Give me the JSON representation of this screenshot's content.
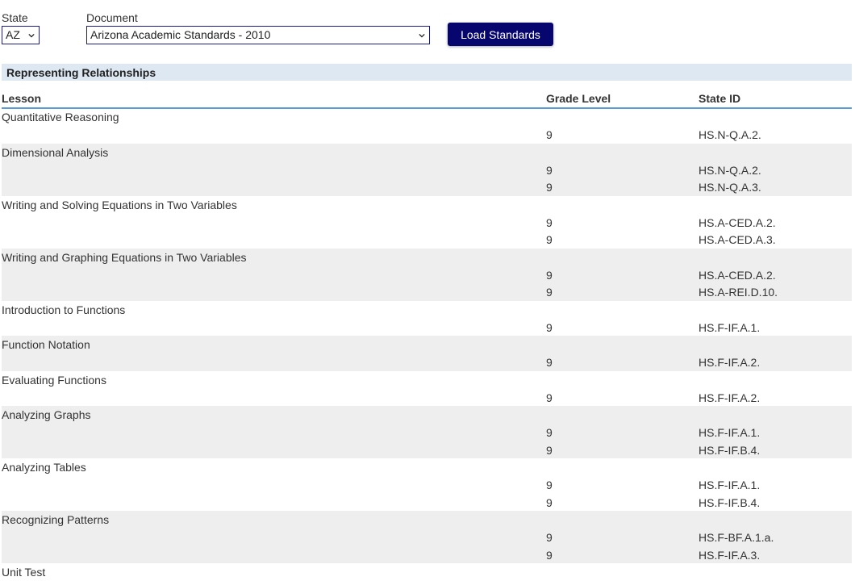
{
  "controls": {
    "state_label": "State",
    "state_value": "AZ",
    "document_label": "Document",
    "document_value": "Arizona Academic Standards - 2010",
    "load_button": "Load Standards"
  },
  "section": {
    "title": "Representing Relationships"
  },
  "columns": {
    "lesson": "Lesson",
    "grade": "Grade Level",
    "state_id": "State ID"
  },
  "lessons": [
    {
      "title": "Quantitative Reasoning",
      "standards": [
        {
          "grade": "9",
          "id": "HS.N-Q.A.2."
        }
      ]
    },
    {
      "title": "Dimensional Analysis",
      "standards": [
        {
          "grade": "9",
          "id": "HS.N-Q.A.2."
        },
        {
          "grade": "9",
          "id": "HS.N-Q.A.3."
        }
      ]
    },
    {
      "title": "Writing and Solving Equations in Two Variables",
      "standards": [
        {
          "grade": "9",
          "id": "HS.A-CED.A.2."
        },
        {
          "grade": "9",
          "id": "HS.A-CED.A.3."
        }
      ]
    },
    {
      "title": "Writing and Graphing Equations in Two Variables",
      "standards": [
        {
          "grade": "9",
          "id": "HS.A-CED.A.2."
        },
        {
          "grade": "9",
          "id": "HS.A-REI.D.10."
        }
      ]
    },
    {
      "title": "Introduction to Functions",
      "standards": [
        {
          "grade": "9",
          "id": "HS.F-IF.A.1."
        }
      ]
    },
    {
      "title": "Function Notation",
      "standards": [
        {
          "grade": "9",
          "id": "HS.F-IF.A.2."
        }
      ]
    },
    {
      "title": "Evaluating Functions",
      "standards": [
        {
          "grade": "9",
          "id": "HS.F-IF.A.2."
        }
      ]
    },
    {
      "title": "Analyzing Graphs",
      "standards": [
        {
          "grade": "9",
          "id": "HS.F-IF.A.1."
        },
        {
          "grade": "9",
          "id": "HS.F-IF.B.4."
        }
      ]
    },
    {
      "title": "Analyzing Tables",
      "standards": [
        {
          "grade": "9",
          "id": "HS.F-IF.A.1."
        },
        {
          "grade": "9",
          "id": "HS.F-IF.B.4."
        }
      ]
    },
    {
      "title": "Recognizing Patterns",
      "standards": [
        {
          "grade": "9",
          "id": "HS.F-BF.A.1.a."
        },
        {
          "grade": "9",
          "id": "HS.F-IF.A.3."
        }
      ]
    },
    {
      "title": "Unit Test",
      "standards": []
    }
  ],
  "icons": {
    "dropdown": "chevron-down-icon"
  },
  "colors": {
    "button_bg": "#06066e",
    "section_header_bg": "#dde8f3",
    "header_rule": "#5a9bd5",
    "row_shade": "#eeeeee"
  }
}
